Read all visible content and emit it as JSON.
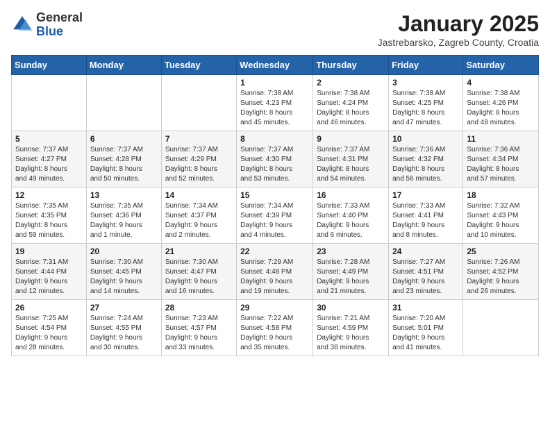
{
  "header": {
    "logo_general": "General",
    "logo_blue": "Blue",
    "month_title": "January 2025",
    "location": "Jastrebarsko, Zagreb County, Croatia"
  },
  "weekdays": [
    "Sunday",
    "Monday",
    "Tuesday",
    "Wednesday",
    "Thursday",
    "Friday",
    "Saturday"
  ],
  "weeks": [
    [
      {
        "day": "",
        "info": ""
      },
      {
        "day": "",
        "info": ""
      },
      {
        "day": "",
        "info": ""
      },
      {
        "day": "1",
        "info": "Sunrise: 7:38 AM\nSunset: 4:23 PM\nDaylight: 8 hours\nand 45 minutes."
      },
      {
        "day": "2",
        "info": "Sunrise: 7:38 AM\nSunset: 4:24 PM\nDaylight: 8 hours\nand 46 minutes."
      },
      {
        "day": "3",
        "info": "Sunrise: 7:38 AM\nSunset: 4:25 PM\nDaylight: 8 hours\nand 47 minutes."
      },
      {
        "day": "4",
        "info": "Sunrise: 7:38 AM\nSunset: 4:26 PM\nDaylight: 8 hours\nand 48 minutes."
      }
    ],
    [
      {
        "day": "5",
        "info": "Sunrise: 7:37 AM\nSunset: 4:27 PM\nDaylight: 8 hours\nand 49 minutes."
      },
      {
        "day": "6",
        "info": "Sunrise: 7:37 AM\nSunset: 4:28 PM\nDaylight: 8 hours\nand 50 minutes."
      },
      {
        "day": "7",
        "info": "Sunrise: 7:37 AM\nSunset: 4:29 PM\nDaylight: 8 hours\nand 52 minutes."
      },
      {
        "day": "8",
        "info": "Sunrise: 7:37 AM\nSunset: 4:30 PM\nDaylight: 8 hours\nand 53 minutes."
      },
      {
        "day": "9",
        "info": "Sunrise: 7:37 AM\nSunset: 4:31 PM\nDaylight: 8 hours\nand 54 minutes."
      },
      {
        "day": "10",
        "info": "Sunrise: 7:36 AM\nSunset: 4:32 PM\nDaylight: 8 hours\nand 56 minutes."
      },
      {
        "day": "11",
        "info": "Sunrise: 7:36 AM\nSunset: 4:34 PM\nDaylight: 8 hours\nand 57 minutes."
      }
    ],
    [
      {
        "day": "12",
        "info": "Sunrise: 7:35 AM\nSunset: 4:35 PM\nDaylight: 8 hours\nand 59 minutes."
      },
      {
        "day": "13",
        "info": "Sunrise: 7:35 AM\nSunset: 4:36 PM\nDaylight: 9 hours\nand 1 minute."
      },
      {
        "day": "14",
        "info": "Sunrise: 7:34 AM\nSunset: 4:37 PM\nDaylight: 9 hours\nand 2 minutes."
      },
      {
        "day": "15",
        "info": "Sunrise: 7:34 AM\nSunset: 4:39 PM\nDaylight: 9 hours\nand 4 minutes."
      },
      {
        "day": "16",
        "info": "Sunrise: 7:33 AM\nSunset: 4:40 PM\nDaylight: 9 hours\nand 6 minutes."
      },
      {
        "day": "17",
        "info": "Sunrise: 7:33 AM\nSunset: 4:41 PM\nDaylight: 9 hours\nand 8 minutes."
      },
      {
        "day": "18",
        "info": "Sunrise: 7:32 AM\nSunset: 4:43 PM\nDaylight: 9 hours\nand 10 minutes."
      }
    ],
    [
      {
        "day": "19",
        "info": "Sunrise: 7:31 AM\nSunset: 4:44 PM\nDaylight: 9 hours\nand 12 minutes."
      },
      {
        "day": "20",
        "info": "Sunrise: 7:30 AM\nSunset: 4:45 PM\nDaylight: 9 hours\nand 14 minutes."
      },
      {
        "day": "21",
        "info": "Sunrise: 7:30 AM\nSunset: 4:47 PM\nDaylight: 9 hours\nand 16 minutes."
      },
      {
        "day": "22",
        "info": "Sunrise: 7:29 AM\nSunset: 4:48 PM\nDaylight: 9 hours\nand 19 minutes."
      },
      {
        "day": "23",
        "info": "Sunrise: 7:28 AM\nSunset: 4:49 PM\nDaylight: 9 hours\nand 21 minutes."
      },
      {
        "day": "24",
        "info": "Sunrise: 7:27 AM\nSunset: 4:51 PM\nDaylight: 9 hours\nand 23 minutes."
      },
      {
        "day": "25",
        "info": "Sunrise: 7:26 AM\nSunset: 4:52 PM\nDaylight: 9 hours\nand 26 minutes."
      }
    ],
    [
      {
        "day": "26",
        "info": "Sunrise: 7:25 AM\nSunset: 4:54 PM\nDaylight: 9 hours\nand 28 minutes."
      },
      {
        "day": "27",
        "info": "Sunrise: 7:24 AM\nSunset: 4:55 PM\nDaylight: 9 hours\nand 30 minutes."
      },
      {
        "day": "28",
        "info": "Sunrise: 7:23 AM\nSunset: 4:57 PM\nDaylight: 9 hours\nand 33 minutes."
      },
      {
        "day": "29",
        "info": "Sunrise: 7:22 AM\nSunset: 4:58 PM\nDaylight: 9 hours\nand 35 minutes."
      },
      {
        "day": "30",
        "info": "Sunrise: 7:21 AM\nSunset: 4:59 PM\nDaylight: 9 hours\nand 38 minutes."
      },
      {
        "day": "31",
        "info": "Sunrise: 7:20 AM\nSunset: 5:01 PM\nDaylight: 9 hours\nand 41 minutes."
      },
      {
        "day": "",
        "info": ""
      }
    ]
  ]
}
